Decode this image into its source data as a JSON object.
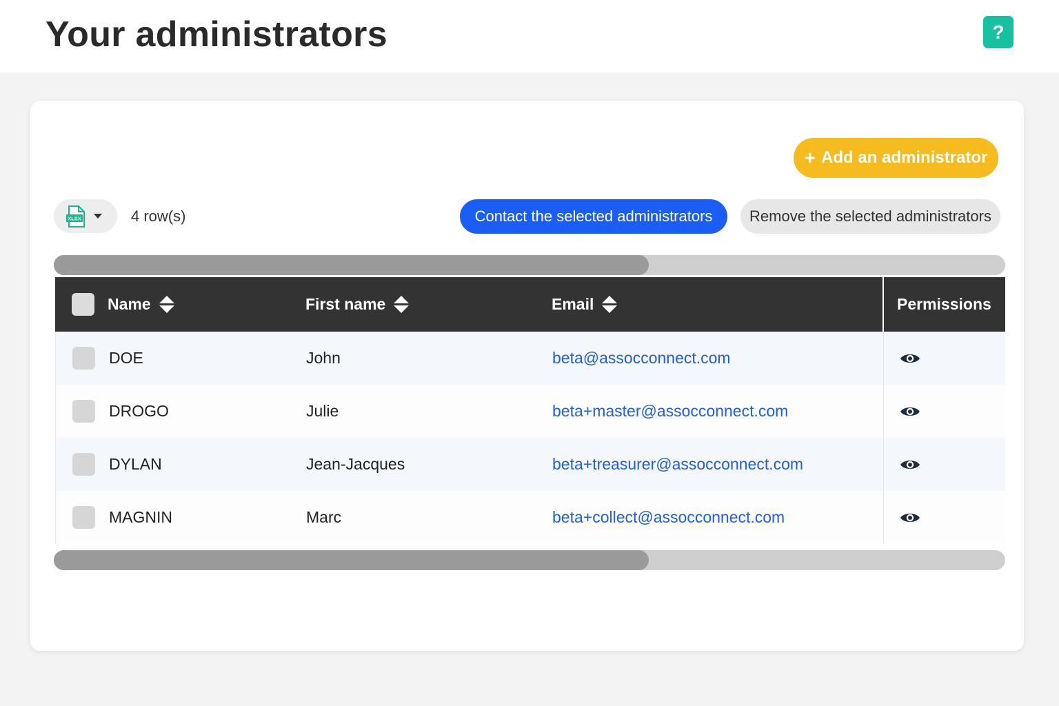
{
  "header": {
    "title": "Your administrators",
    "help_label": "?"
  },
  "toolbar": {
    "add_label": "Add an administrator",
    "add_plus": "+",
    "export_icon_text": "XLSX",
    "row_count": "4 row(s)",
    "contact_label": "Contact the selected administrators",
    "remove_label": "Remove the selected administrators"
  },
  "scrollbar": {
    "thumb_fraction": 0.625
  },
  "table": {
    "columns": {
      "name": "Name",
      "first_name": "First name",
      "email": "Email",
      "permissions": "Permissions"
    },
    "rows": [
      {
        "name": "DOE",
        "first_name": "John",
        "email": "beta@assocconnect.com"
      },
      {
        "name": "DROGO",
        "first_name": "Julie",
        "email": "beta+master@assocconnect.com"
      },
      {
        "name": "DYLAN",
        "first_name": "Jean-Jacques",
        "email": "beta+treasurer@assocconnect.com"
      },
      {
        "name": "MAGNIN",
        "first_name": "Marc",
        "email": "beta+collect@assocconnect.com"
      }
    ]
  },
  "colors": {
    "help": "#17c0a0",
    "add": "#f6bb1e",
    "contact": "#1b5ef5",
    "email_link": "#1f5fe0",
    "table_header": "#333333"
  },
  "icons": [
    "help-icon",
    "xlsx-file-icon",
    "caret-down-icon",
    "sort-icon",
    "eye-icon"
  ]
}
